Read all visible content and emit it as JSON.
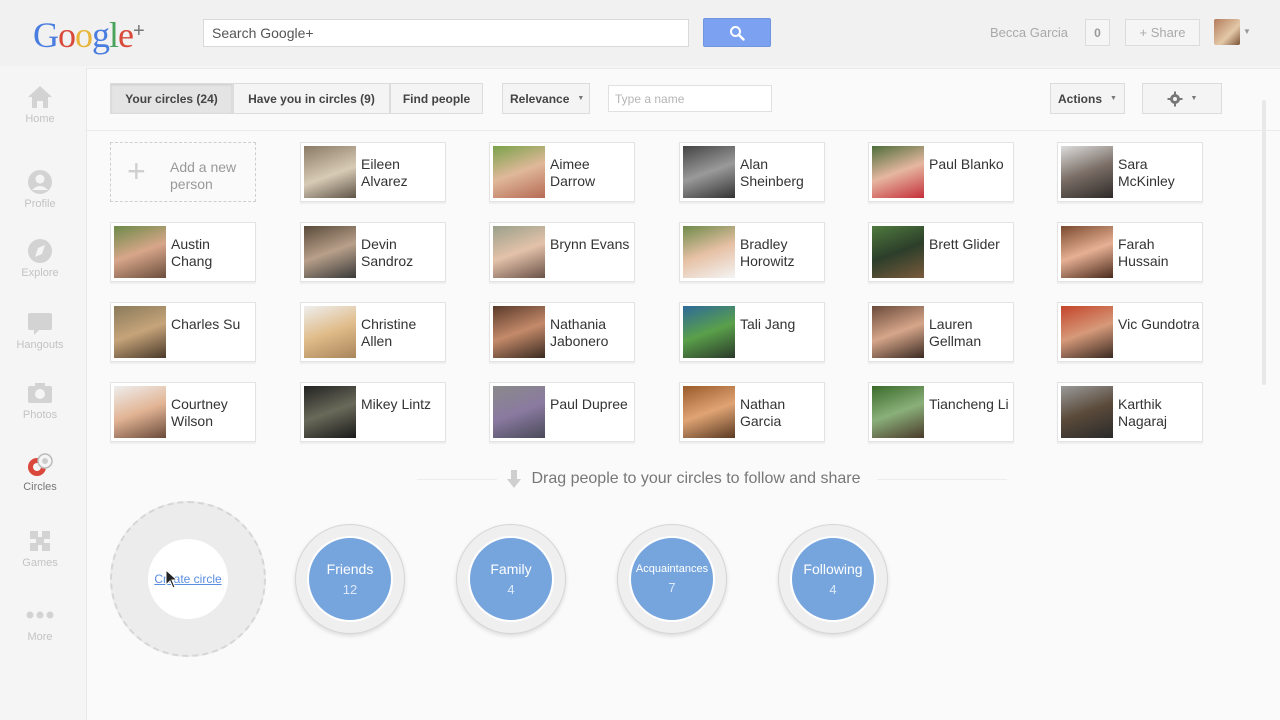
{
  "header": {
    "logo": "Google+",
    "search_placeholder": "Search Google+",
    "user_name": "Becca Garcia",
    "notification_count": "0",
    "share_label": "+ Share"
  },
  "sidebar": {
    "items": [
      {
        "label": "Home",
        "icon": "home-icon"
      },
      {
        "label": "Profile",
        "icon": "profile-icon"
      },
      {
        "label": "Explore",
        "icon": "explore-icon"
      },
      {
        "label": "Hangouts",
        "icon": "hangouts-icon"
      },
      {
        "label": "Photos",
        "icon": "photos-icon"
      },
      {
        "label": "Circles",
        "icon": "circles-icon",
        "active": true
      },
      {
        "label": "Games",
        "icon": "games-icon"
      },
      {
        "label": "More",
        "icon": "more-icon"
      }
    ]
  },
  "toolbar": {
    "tabs": [
      {
        "label": "Your circles (24)",
        "active": true
      },
      {
        "label": "Have you in circles (9)"
      },
      {
        "label": "Find people"
      }
    ],
    "sort_label": "Relevance",
    "name_placeholder": "Type a name",
    "actions_label": "Actions"
  },
  "add_person_label": "Add a new person",
  "people": [
    [
      "Eileen Alvarez",
      "Aimee Darrow",
      "Alan Sheinberg",
      "Paul Blanko",
      "Sara McKinley"
    ],
    [
      "Austin Chang",
      "Devin Sandroz",
      "Brynn Evans",
      "Bradley Horowitz",
      "Brett Glider",
      "Farah Hussain"
    ],
    [
      "Charles Su",
      "Christine Allen",
      "Nathania Jabonero",
      "Tali Jang",
      "Lauren Gellman",
      "Vic Gundotra"
    ],
    [
      "Courtney Wilson",
      "Mikey Lintz",
      "Paul Dupree",
      "Nathan Garcia",
      "Tiancheng Li",
      "Karthik Nagaraj"
    ]
  ],
  "drag_hint": "Drag people to your circles to follow and share",
  "create_circle_label": "Create circle",
  "circles": [
    {
      "name": "Friends",
      "count": "12"
    },
    {
      "name": "Family",
      "count": "4"
    },
    {
      "name": "Acquaintances",
      "count": "7"
    },
    {
      "name": "Following",
      "count": "4"
    }
  ],
  "colors": {
    "accent_blue": "#76a5de",
    "search_button": "#7ba1f0",
    "circles_active": "#d9483b"
  }
}
